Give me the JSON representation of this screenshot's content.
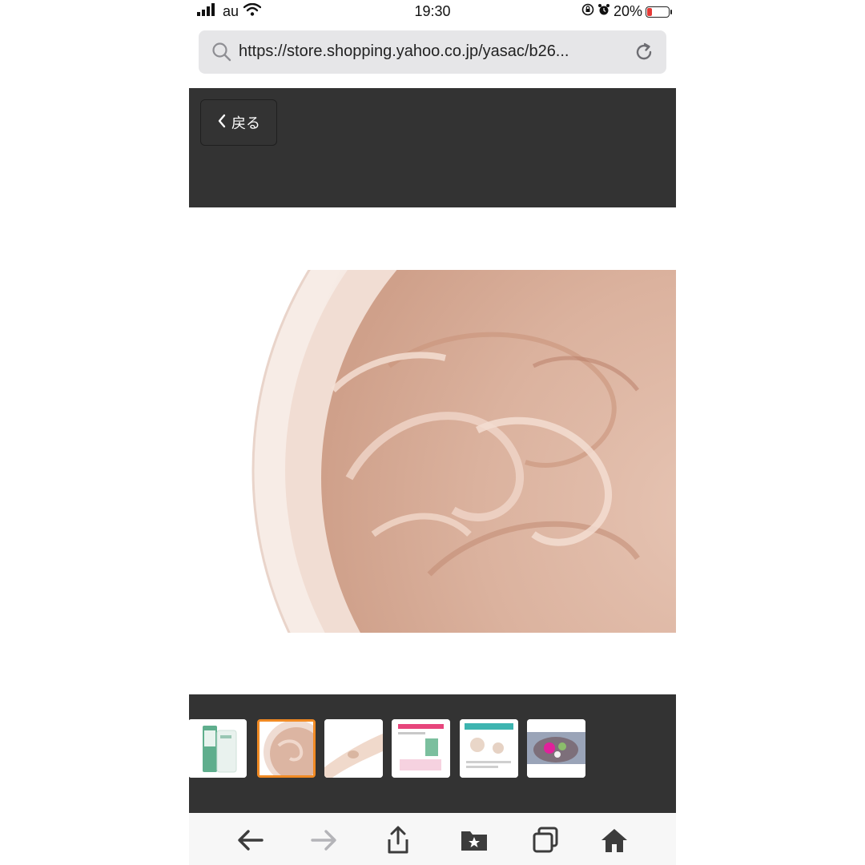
{
  "status_bar": {
    "carrier": "au",
    "time": "19:30",
    "battery_text": "20%",
    "battery_level": 0.2,
    "battery_color": "#e53935"
  },
  "browser": {
    "url": "https://store.shopping.yahoo.co.jp/yasac/b26...",
    "icons": [
      "search-icon",
      "reload-icon"
    ]
  },
  "header": {
    "back_label": "戻る",
    "background": "#333333"
  },
  "gallery": {
    "thumbnails": [
      "product-tube",
      "cream-jar",
      "hand-swatch",
      "flyer-pink",
      "flyer-teal",
      "flowers-bowl"
    ],
    "selected_index": 1,
    "selected_color": "#f08a24"
  },
  "toolbar": {
    "icons": [
      "back-arrow-icon",
      "forward-arrow-icon",
      "share-icon",
      "bookmarks-icon",
      "tabs-icon",
      "home-icon"
    ]
  }
}
